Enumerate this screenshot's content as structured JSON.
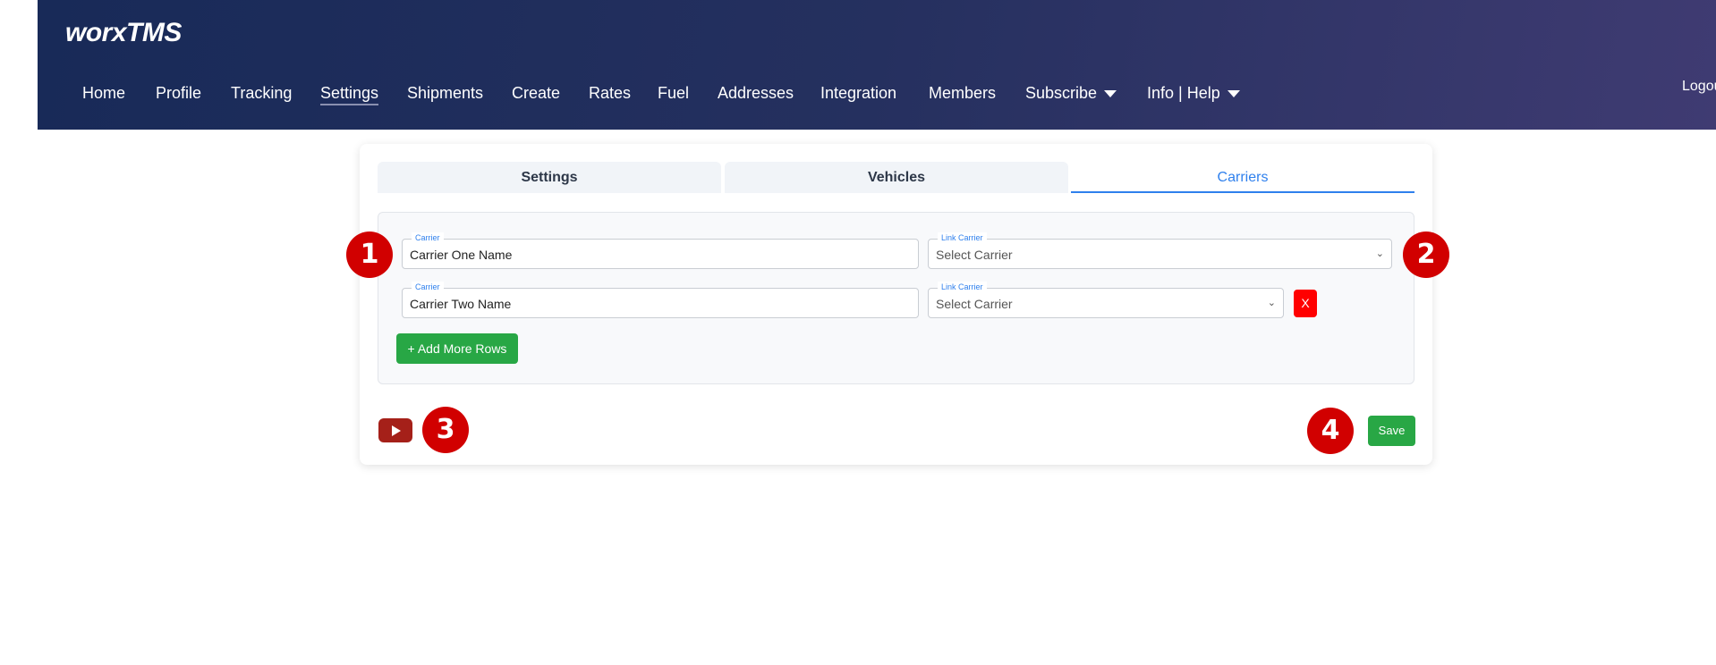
{
  "header": {
    "logo": "worxTMS",
    "nav": [
      "Home",
      "Profile",
      "Tracking",
      "Settings",
      "Shipments",
      "Create",
      "Rates",
      "Fuel",
      "Addresses",
      "Integration",
      "Members",
      "Subscribe",
      "Info | Help"
    ],
    "logout": "Logout"
  },
  "tabs": [
    "Settings",
    "Vehicles",
    "Carriers"
  ],
  "rows": [
    {
      "carrier_label": "Carrier",
      "carrier_value": "Carrier One Name",
      "link_label": "Link Carrier",
      "link_value": "Select Carrier"
    },
    {
      "carrier_label": "Carrier",
      "carrier_value": "Carrier Two Name",
      "link_label": "Link Carrier",
      "link_value": "Select Carrier",
      "remove_label": "X"
    }
  ],
  "add_rows_label": "+ Add More Rows",
  "save_label": "Save",
  "badges": [
    "1",
    "2",
    "3",
    "4"
  ],
  "colors": {
    "accent": "#2f80ed",
    "success": "#28a745",
    "danger": "#ff0000",
    "badge": "#d10000"
  }
}
